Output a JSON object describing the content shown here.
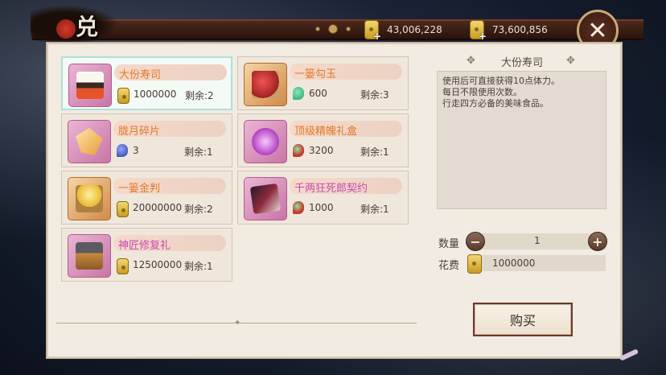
{
  "header": {
    "title": "兑换",
    "currency1": "43,006,228",
    "currency2": "73,600,856"
  },
  "items": [
    {
      "name": "大份寿司",
      "price": "1000000",
      "remain": "剩余:2",
      "name_color": "orange",
      "cost_icon": "gold-coin-icon",
      "icon": "sushi-box-icon",
      "selected": true
    },
    {
      "name": "一篓勾玉",
      "price": "600",
      "remain": "剩余:3",
      "name_color": "orange",
      "cost_icon": "green-jade-icon",
      "icon": "magatama-basket-icon"
    },
    {
      "name": "胧月碎片",
      "price": "3",
      "remain": "剩余:1",
      "name_color": "orange",
      "cost_icon": "blue-jade-icon",
      "icon": "crystal-shard-icon"
    },
    {
      "name": "顶级精魄礼盒",
      "price": "3200",
      "remain": "剩余:1",
      "name_color": "orange",
      "cost_icon": "red-jade-icon",
      "icon": "soul-gift-box-icon"
    },
    {
      "name": "一篓金判",
      "price": "20000000",
      "remain": "剩余:2",
      "name_color": "orange",
      "cost_icon": "gold-coin-icon",
      "icon": "gold-basket-icon"
    },
    {
      "name": "千两狂死郎契约",
      "price": "1000",
      "remain": "剩余:1",
      "name_color": "pink",
      "cost_icon": "red-jade-icon",
      "icon": "contract-card-icon"
    },
    {
      "name": "神匠修复礼",
      "price": "12500000",
      "remain": "剩余:1",
      "name_color": "pink",
      "cost_icon": "gold-coin-icon",
      "icon": "repair-chest-icon"
    }
  ],
  "detail": {
    "title": "大份寿司",
    "desc": [
      "使用后可直接获得10点体力。",
      "每日不限使用次数。",
      "行走四方必备的美味食品。"
    ],
    "qty_label": "数量",
    "qty_value": "1",
    "cost_label": "花费",
    "cost_value": "1000000",
    "buy_label": "购买"
  },
  "colors": {
    "orange_name": "#e07a2c",
    "pink_name": "#c84ab0",
    "panel_bg": "#f1ebe2",
    "button_border": "#6a3a2a"
  }
}
